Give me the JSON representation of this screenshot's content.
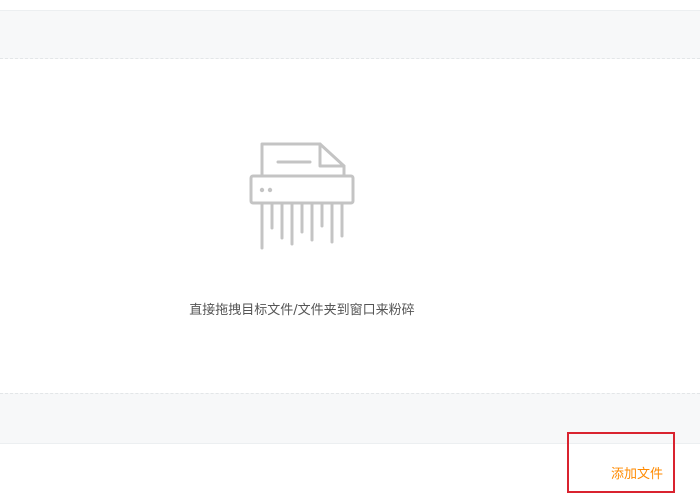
{
  "drop_zone": {
    "hint": "直接拖拽目标文件/文件夹到窗口来粉碎",
    "icon": "shredder-icon"
  },
  "footer": {
    "add_file_label": "添加文件"
  },
  "colors": {
    "accent": "#ff8a00",
    "highlight_border": "#d9232f",
    "strip_bg": "#f7f8f9",
    "icon_gray": "#c4c4c4",
    "hint_text": "#555555"
  }
}
